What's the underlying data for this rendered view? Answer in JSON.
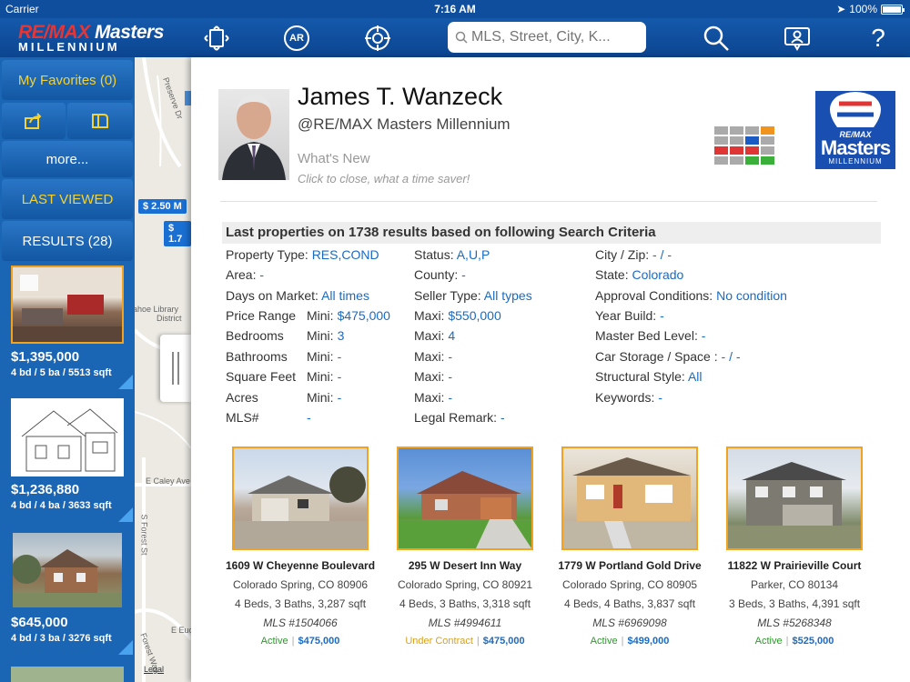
{
  "status_bar": {
    "carrier": "Carrier",
    "time": "7:16 AM",
    "battery": "100%"
  },
  "header": {
    "logo_line1_re": "RE/MAX",
    "logo_line1_rest": " Masters",
    "logo_line2": "MILLENNIUM",
    "nav_icons": [
      "fullscreen-icon",
      "ar-icon",
      "location-target-icon",
      "search-icon",
      "agent-contact-icon",
      "help-icon"
    ],
    "ar_label": "AR",
    "help_label": "?",
    "search_placeholder": "MLS, Street, City, K..."
  },
  "sidebar": {
    "favorites": "My Favorites (0)",
    "more": "more...",
    "last_viewed": "LAST VIEWED",
    "results": "RESULTS (28)",
    "listings": [
      {
        "price": "$1,395,000",
        "specs": "4 bd / 5 ba / 5513 sqft"
      },
      {
        "price": "$1,236,880",
        "specs": "4 bd / 4 ba / 3633 sqft"
      },
      {
        "price": "$645,000",
        "specs": "4 bd / 3 ba / 3276 sqft"
      }
    ]
  },
  "map": {
    "price_pins": [
      "$ 2.50 M",
      "$ 1.7"
    ],
    "labels": [
      "Preserve Dr",
      "ahoe Library",
      "District",
      "E Caley Ave",
      "S Forest St",
      "E Euc",
      "Legal",
      "Forest Way"
    ]
  },
  "agent": {
    "name": "James T.  Wanzeck",
    "company": "@RE/MAX Masters Millennium",
    "whats_new": "What's New",
    "whats_new_sub": "Click to close, what a time saver!",
    "brand_line1": "RE/MAX",
    "brand_line2": "Masters",
    "brand_line3": "MILLENNIUM"
  },
  "criteria": {
    "title": "Last properties on 1738 results based on following Search Criteria",
    "col1": [
      {
        "label": "Property Type:",
        "value": "RES,COND"
      },
      {
        "label": "Area:",
        "value": "-"
      },
      {
        "label": "Days on Market:",
        "value": "All times"
      },
      {
        "label": "Price Range",
        "mini": "Mini:",
        "value": "$475,000"
      },
      {
        "label": "Bedrooms",
        "mini": "Mini:",
        "value": "3"
      },
      {
        "label": "Bathrooms",
        "mini": "Mini:",
        "value": "-"
      },
      {
        "label": "Square Feet",
        "mini": "Mini:",
        "value": "-"
      },
      {
        "label": "Acres",
        "mini": "Mini:",
        "value": "-"
      },
      {
        "label": "MLS#",
        "value": "-"
      }
    ],
    "col2": [
      {
        "label": "Status:",
        "value": "A,U,P"
      },
      {
        "label": "County:",
        "value": "-"
      },
      {
        "label": "Seller Type:",
        "value": "All types"
      },
      {
        "label": "Maxi:",
        "value": "$550,000"
      },
      {
        "label": "Maxi:",
        "value": "4"
      },
      {
        "label": "Maxi:",
        "value": "-"
      },
      {
        "label": "Maxi:",
        "value": "-"
      },
      {
        "label": "Maxi:",
        "value": "-"
      },
      {
        "label": "Legal Remark:",
        "value": "-"
      }
    ],
    "col3": [
      {
        "label": "City / Zip:",
        "value": "- / -"
      },
      {
        "label": "State:",
        "value": "Colorado"
      },
      {
        "label": "Approval Conditions:",
        "value": "No condition"
      },
      {
        "label": "Year Build:",
        "value": "-"
      },
      {
        "label": "Master Bed Level:",
        "value": "-"
      },
      {
        "label": "Car Storage / Space :",
        "value": "- / -"
      },
      {
        "label": "Structural Style:",
        "value": "All"
      },
      {
        "label": "Keywords:",
        "value": "-"
      }
    ]
  },
  "properties": [
    {
      "address": "1609  W Cheyenne Boulevard",
      "city": "Colorado Spring, CO 80906",
      "specs": "4 Beds, 3 Baths, 3,287 sqft",
      "mls": "MLS #1504066",
      "status": "Active",
      "status_color": "#2a9a2a",
      "price": "$475,000"
    },
    {
      "address": "295  W Desert Inn Way",
      "city": "Colorado Spring, CO 80921",
      "specs": "4 Beds, 3 Baths, 3,318 sqft",
      "mls": "MLS #4994611",
      "status": "Under Contract",
      "status_color": "#d9a021",
      "price": "$475,000"
    },
    {
      "address": "1779  W Portland Gold Drive",
      "city": "Colorado Spring, CO 80905",
      "specs": "4 Beds, 4 Baths, 3,837 sqft",
      "mls": "MLS #6969098",
      "status": "Active",
      "status_color": "#2a9a2a",
      "price": "$499,000"
    },
    {
      "address": "11822  W Prairieville Court",
      "city": "Parker, CO 80134",
      "specs": "3 Beds, 3 Baths, 4,391 sqft",
      "mls": "MLS #5268348",
      "status": "Active",
      "status_color": "#2a9a2a",
      "price": "$525,000"
    }
  ],
  "colors": {
    "brand_blue": "#0e4e9c",
    "accent_yellow": "#f5d230",
    "link_blue": "#1a6bc2",
    "thumb_border": "#f3a21e"
  }
}
